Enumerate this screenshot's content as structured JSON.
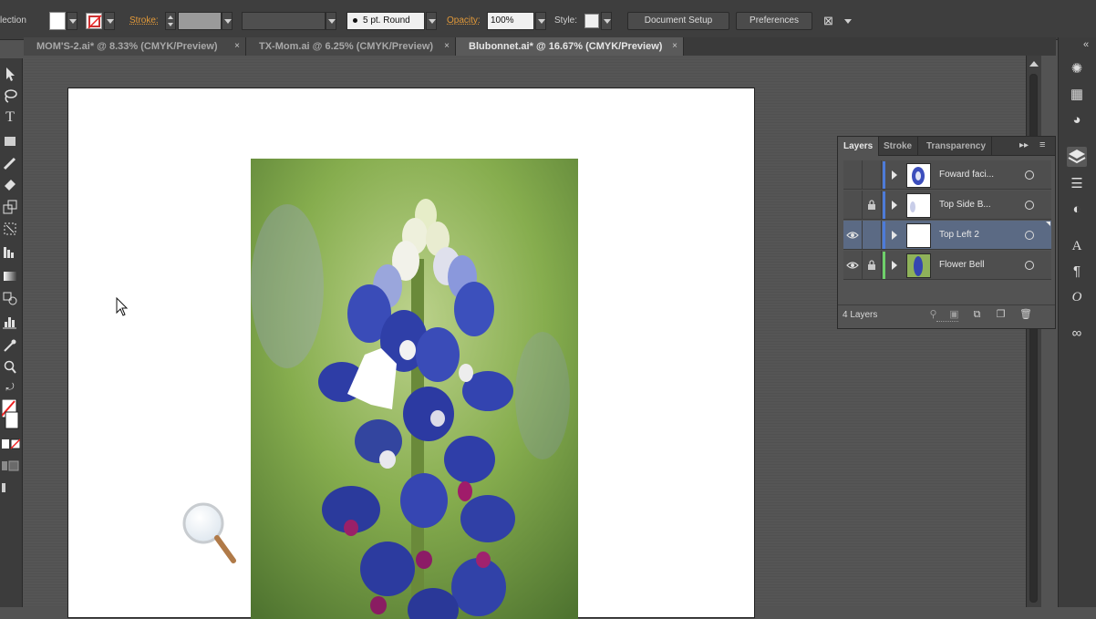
{
  "control_bar": {
    "selection_label": "lection",
    "stroke_label": "Stroke:",
    "brush": "5 pt. Round",
    "opacity_label": "Opacity:",
    "opacity_value": "100%",
    "style_label": "Style:",
    "document_setup": "Document Setup",
    "preferences": "Preferences"
  },
  "tabs": [
    {
      "label": "MOM'S-2.ai* @ 8.33% (CMYK/Preview)",
      "close": "×"
    },
    {
      "label": "TX-Mom.ai @ 6.25% (CMYK/Preview)",
      "close": "×"
    },
    {
      "label": "Blubonnet.ai* @ 16.67% (CMYK/Preview)",
      "close": "×"
    }
  ],
  "layers_panel": {
    "tabs": [
      "Layers",
      "Stroke",
      "Transparency"
    ],
    "layers": [
      {
        "name": "Foward faci...",
        "visible": false,
        "locked": false,
        "color": "#4d7bd8",
        "selected": false
      },
      {
        "name": "Top Side B...",
        "visible": false,
        "locked": true,
        "color": "#4d7bd8",
        "selected": false
      },
      {
        "name": "Top Left 2",
        "visible": true,
        "locked": false,
        "color": "#4d7bd8",
        "selected": true
      },
      {
        "name": "Flower Bell",
        "visible": true,
        "locked": true,
        "color": "#6fd06a",
        "selected": false
      }
    ],
    "layer_count": "4 Layers"
  },
  "icons": {
    "eye": "👁",
    "lock": "🔒"
  }
}
